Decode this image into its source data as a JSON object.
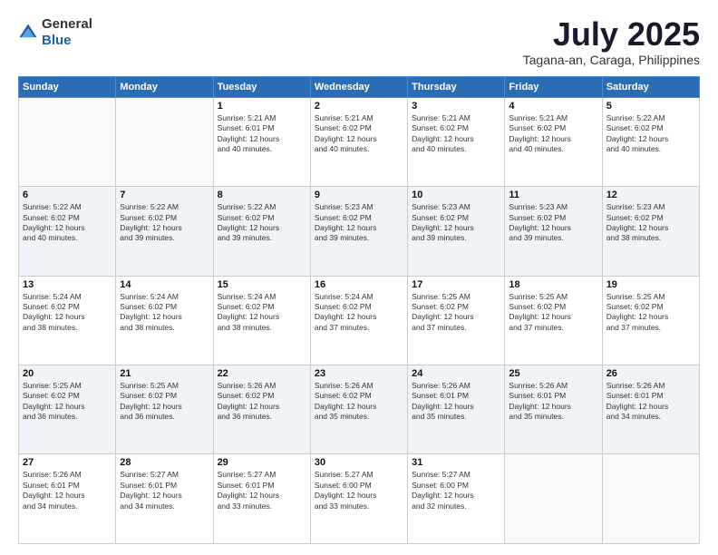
{
  "header": {
    "logo_general": "General",
    "logo_blue": "Blue",
    "main_title": "July 2025",
    "subtitle": "Tagana-an, Caraga, Philippines"
  },
  "days_of_week": [
    "Sunday",
    "Monday",
    "Tuesday",
    "Wednesday",
    "Thursday",
    "Friday",
    "Saturday"
  ],
  "weeks": [
    [
      {
        "day": "",
        "info": ""
      },
      {
        "day": "",
        "info": ""
      },
      {
        "day": "1",
        "info": "Sunrise: 5:21 AM\nSunset: 6:01 PM\nDaylight: 12 hours\nand 40 minutes."
      },
      {
        "day": "2",
        "info": "Sunrise: 5:21 AM\nSunset: 6:02 PM\nDaylight: 12 hours\nand 40 minutes."
      },
      {
        "day": "3",
        "info": "Sunrise: 5:21 AM\nSunset: 6:02 PM\nDaylight: 12 hours\nand 40 minutes."
      },
      {
        "day": "4",
        "info": "Sunrise: 5:21 AM\nSunset: 6:02 PM\nDaylight: 12 hours\nand 40 minutes."
      },
      {
        "day": "5",
        "info": "Sunrise: 5:22 AM\nSunset: 6:02 PM\nDaylight: 12 hours\nand 40 minutes."
      }
    ],
    [
      {
        "day": "6",
        "info": "Sunrise: 5:22 AM\nSunset: 6:02 PM\nDaylight: 12 hours\nand 40 minutes."
      },
      {
        "day": "7",
        "info": "Sunrise: 5:22 AM\nSunset: 6:02 PM\nDaylight: 12 hours\nand 39 minutes."
      },
      {
        "day": "8",
        "info": "Sunrise: 5:22 AM\nSunset: 6:02 PM\nDaylight: 12 hours\nand 39 minutes."
      },
      {
        "day": "9",
        "info": "Sunrise: 5:23 AM\nSunset: 6:02 PM\nDaylight: 12 hours\nand 39 minutes."
      },
      {
        "day": "10",
        "info": "Sunrise: 5:23 AM\nSunset: 6:02 PM\nDaylight: 12 hours\nand 39 minutes."
      },
      {
        "day": "11",
        "info": "Sunrise: 5:23 AM\nSunset: 6:02 PM\nDaylight: 12 hours\nand 39 minutes."
      },
      {
        "day": "12",
        "info": "Sunrise: 5:23 AM\nSunset: 6:02 PM\nDaylight: 12 hours\nand 38 minutes."
      }
    ],
    [
      {
        "day": "13",
        "info": "Sunrise: 5:24 AM\nSunset: 6:02 PM\nDaylight: 12 hours\nand 38 minutes."
      },
      {
        "day": "14",
        "info": "Sunrise: 5:24 AM\nSunset: 6:02 PM\nDaylight: 12 hours\nand 38 minutes."
      },
      {
        "day": "15",
        "info": "Sunrise: 5:24 AM\nSunset: 6:02 PM\nDaylight: 12 hours\nand 38 minutes."
      },
      {
        "day": "16",
        "info": "Sunrise: 5:24 AM\nSunset: 6:02 PM\nDaylight: 12 hours\nand 37 minutes."
      },
      {
        "day": "17",
        "info": "Sunrise: 5:25 AM\nSunset: 6:02 PM\nDaylight: 12 hours\nand 37 minutes."
      },
      {
        "day": "18",
        "info": "Sunrise: 5:25 AM\nSunset: 6:02 PM\nDaylight: 12 hours\nand 37 minutes."
      },
      {
        "day": "19",
        "info": "Sunrise: 5:25 AM\nSunset: 6:02 PM\nDaylight: 12 hours\nand 37 minutes."
      }
    ],
    [
      {
        "day": "20",
        "info": "Sunrise: 5:25 AM\nSunset: 6:02 PM\nDaylight: 12 hours\nand 36 minutes."
      },
      {
        "day": "21",
        "info": "Sunrise: 5:25 AM\nSunset: 6:02 PM\nDaylight: 12 hours\nand 36 minutes."
      },
      {
        "day": "22",
        "info": "Sunrise: 5:26 AM\nSunset: 6:02 PM\nDaylight: 12 hours\nand 36 minutes."
      },
      {
        "day": "23",
        "info": "Sunrise: 5:26 AM\nSunset: 6:02 PM\nDaylight: 12 hours\nand 35 minutes."
      },
      {
        "day": "24",
        "info": "Sunrise: 5:26 AM\nSunset: 6:01 PM\nDaylight: 12 hours\nand 35 minutes."
      },
      {
        "day": "25",
        "info": "Sunrise: 5:26 AM\nSunset: 6:01 PM\nDaylight: 12 hours\nand 35 minutes."
      },
      {
        "day": "26",
        "info": "Sunrise: 5:26 AM\nSunset: 6:01 PM\nDaylight: 12 hours\nand 34 minutes."
      }
    ],
    [
      {
        "day": "27",
        "info": "Sunrise: 5:26 AM\nSunset: 6:01 PM\nDaylight: 12 hours\nand 34 minutes."
      },
      {
        "day": "28",
        "info": "Sunrise: 5:27 AM\nSunset: 6:01 PM\nDaylight: 12 hours\nand 34 minutes."
      },
      {
        "day": "29",
        "info": "Sunrise: 5:27 AM\nSunset: 6:01 PM\nDaylight: 12 hours\nand 33 minutes."
      },
      {
        "day": "30",
        "info": "Sunrise: 5:27 AM\nSunset: 6:00 PM\nDaylight: 12 hours\nand 33 minutes."
      },
      {
        "day": "31",
        "info": "Sunrise: 5:27 AM\nSunset: 6:00 PM\nDaylight: 12 hours\nand 32 minutes."
      },
      {
        "day": "",
        "info": ""
      },
      {
        "day": "",
        "info": ""
      }
    ]
  ]
}
